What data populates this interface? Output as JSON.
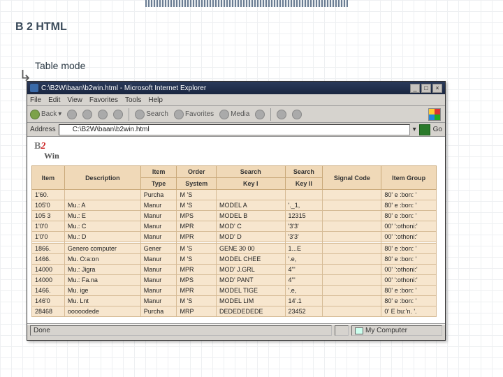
{
  "slide": {
    "title": "B 2 HTML",
    "subtitle": "Table mode"
  },
  "window": {
    "title": "C:\\B2W\\baan\\b2win.html - Microsoft Internet Explorer",
    "min": "_",
    "max": "□",
    "close": "×"
  },
  "menu": {
    "file": "File",
    "edit": "Edit",
    "view": "View",
    "favorites": "Favorites",
    "tools": "Tools",
    "help": "Help"
  },
  "toolbar": {
    "back": "Back",
    "search": "Search",
    "favorites": "Favorites",
    "media": "Media"
  },
  "address": {
    "label": "Address",
    "value": "C:\\B2W\\baan\\b2win.html",
    "go": "Go"
  },
  "logo": {
    "b": "B",
    "two": "2",
    "win": "Win"
  },
  "headers": {
    "item": "Item",
    "description": "Description",
    "item_type": "Item Type",
    "order_system": "Order System",
    "search_key1": "Search Key I",
    "search_key2": "Search Key II",
    "signal_code": "Signal Code",
    "item_group": "Item Group"
  },
  "rows": [
    {
      "item": "1'60.",
      "desc": "",
      "type": "Purcha",
      "order": "M  'S",
      "k1": "",
      "k2": "",
      "sig": "",
      "grp": "80' e :bon: '"
    },
    {
      "item": "105'0",
      "desc": "Mu.: A",
      "type": "Manur",
      "order": "M  'S",
      "k1": "MODEL A",
      "k2": "'._1,",
      "sig": "",
      "grp": "80' e :bon: '"
    },
    {
      "item": "105 3",
      "desc": "Mu.: E",
      "type": "Manur",
      "order": "MPS",
      "k1": "MODEL B",
      "k2": "12315",
      "sig": "",
      "grp": "80' e :bon: '"
    },
    {
      "item": "1'0'0",
      "desc": "Mu.: C",
      "type": "Manur",
      "order": "MPR",
      "k1": "MOD' C",
      "k2": "'3'3'",
      "sig": "",
      "grp": "00' ':othoni:'"
    },
    {
      "item": "1'0'0",
      "desc": "Mu.: D",
      "type": "Manur",
      "order": "MPR",
      "k1": "MOD' D",
      "k2": "'3'3'",
      "sig": "",
      "grp": "00' ':othoni:'"
    },
    {
      "item": "_sep_"
    },
    {
      "item": "1866.",
      "desc": "Genero computer",
      "type": "Gener",
      "order": "M  'S",
      "k1": "GENE 30 00",
      "k2": "1...E",
      "sig": "",
      "grp": "80' e :bon: '"
    },
    {
      "item": "1466.",
      "desc": "Mu. O:a:on",
      "type": "Manur",
      "order": "M  'S",
      "k1": "MODEL CHEE",
      "k2": "'.e,",
      "sig": "",
      "grp": "80' e :bon: '"
    },
    {
      "item": "14000",
      "desc": "Mu.: Jigra",
      "type": "Manur",
      "order": "MPR",
      "k1": "MOD' J.GRL",
      "k2": "4'''",
      "sig": "",
      "grp": "00' ':othoni:'"
    },
    {
      "item": "14000",
      "desc": "Mu.: Fa.na",
      "type": "Manur",
      "order": "MPS",
      "k1": "MOD' PANT",
      "k2": "4'''",
      "sig": "",
      "grp": "00' ':othoni:'"
    },
    {
      "item": "1466.",
      "desc": "Mu. ige",
      "type": "Manur",
      "order": "MPR",
      "k1": "MODEL TIGE",
      "k2": "'.e,",
      "sig": "",
      "grp": "80' e :bon: '"
    },
    {
      "item": "146'0",
      "desc": "Mu. Lnt",
      "type": "Manur",
      "order": "M 'S",
      "k1": "MODEL LIM",
      "k2": "14'.1",
      "sig": "",
      "grp": "80' e :bon: '"
    },
    {
      "item": "28468",
      "desc": "ooooodede",
      "type": "Purcha",
      "order": "MRP",
      "k1": "DEDEDEDEDE",
      "k2": "23452",
      "sig": "",
      "grp": "0' E bu:'n. '."
    }
  ],
  "status": {
    "left": "Done",
    "right": "My Computer"
  }
}
